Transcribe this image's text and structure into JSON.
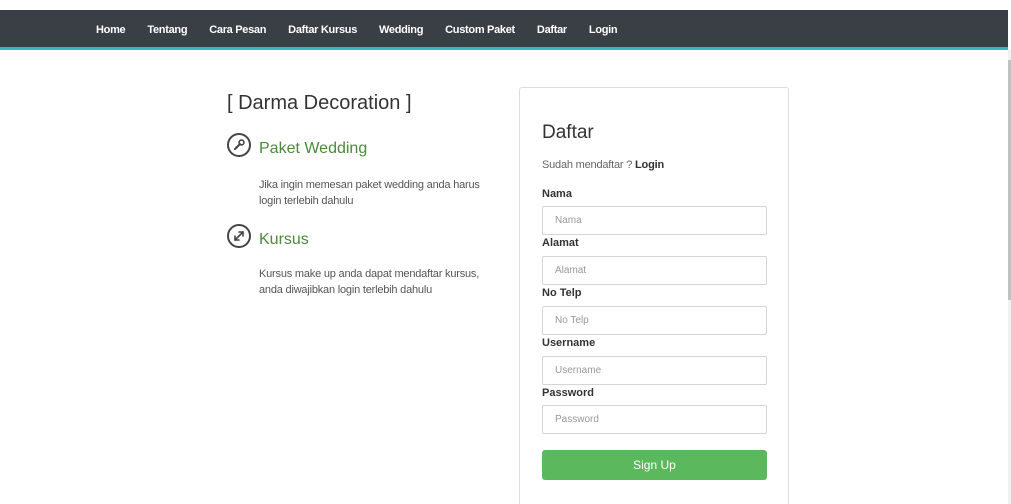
{
  "nav": {
    "items": [
      "Home",
      "Tentang",
      "Cara Pesan",
      "Daftar Kursus",
      "Wedding",
      "Custom Paket",
      "Daftar",
      "Login"
    ]
  },
  "intro": {
    "brand": "[ Darma Decoration ]",
    "features": [
      {
        "icon": "wrench-icon",
        "title": "Paket Wedding",
        "desc": "Jika ingin memesan paket wedding anda harus login terlebih dahulu"
      },
      {
        "icon": "expand-arrows-icon",
        "title": "Kursus",
        "desc": "Kursus make up anda dapat mendaftar kursus, anda diwajibkan login terlebih dahulu"
      }
    ]
  },
  "form": {
    "title": "Daftar",
    "subtitle": "Sudah mendaftar ?",
    "login_link": "Login",
    "fields": [
      {
        "label": "Nama",
        "placeholder": "Nama"
      },
      {
        "label": "Alamat",
        "placeholder": "Alamat"
      },
      {
        "label": "No Telp",
        "placeholder": "No Telp"
      },
      {
        "label": "Username",
        "placeholder": "Username"
      },
      {
        "label": "Password",
        "placeholder": "Password"
      }
    ],
    "submit_label": "Sign Up"
  },
  "colors": {
    "navbar": "#3a3f45",
    "navbar_accent": "#35b8c4",
    "feature_title": "#4a8a3a",
    "button": "#5cb85c"
  }
}
